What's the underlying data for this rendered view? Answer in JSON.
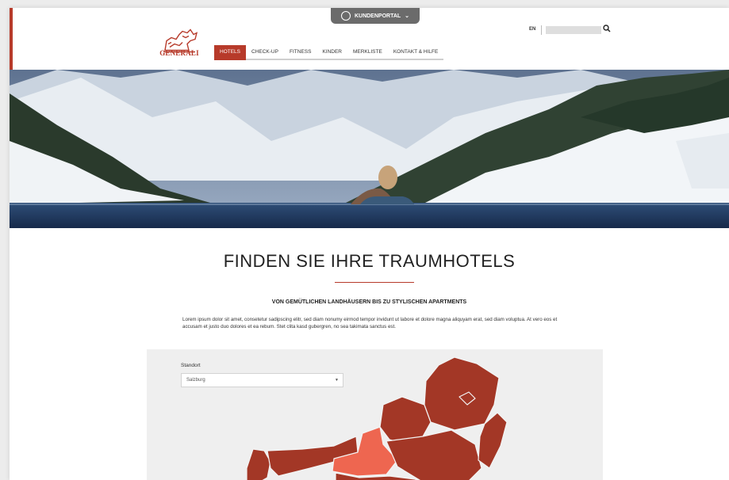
{
  "portal": {
    "label": "KUNDENPORTAL",
    "icon": "portal-ring-icon",
    "chevron": "⌄"
  },
  "brand": {
    "name": "GENERALI",
    "logo": "winged-lion-logo",
    "color": "#b73a2a"
  },
  "nav": {
    "items": [
      {
        "label": "HOTELS",
        "active": true
      },
      {
        "label": "CHECK-UP",
        "active": false
      },
      {
        "label": "FITNESS",
        "active": false
      },
      {
        "label": "KINDER",
        "active": false
      },
      {
        "label": "MERKLISTE",
        "active": false
      },
      {
        "label": "KONTAKT & HILFE",
        "active": false
      }
    ]
  },
  "header": {
    "language": "EN",
    "search_placeholder": "",
    "search_icon": "⚲"
  },
  "hero": {
    "image": "alpine-infinity-pool-photo"
  },
  "main": {
    "headline": "FINDEN SIE IHRE TRAUMHOTELS",
    "subhead": "VON GEMÜTLICHEN LANDHÄUSERN BIS ZU STYLISCHEN APARTMENTS",
    "body": "Lorem ipsum dolor sit amet, consetetur sadipscing elitr, sed diam nonumy eirmod tempor invidunt ut labore et dolore magna aliquyam erat, sed diam voluptua. At vero eos et accusam et justo duo dolores et ea rebum. Stet clita kasd gubergren, no sea takimata sanctus est."
  },
  "finder": {
    "label": "Standort",
    "selected": "Salzburg",
    "caret": "▼",
    "map": {
      "name": "austria-region-map",
      "region_color": "#a33726",
      "highlight_color": "#ee6650",
      "highlighted_region": "Salzburg"
    }
  }
}
